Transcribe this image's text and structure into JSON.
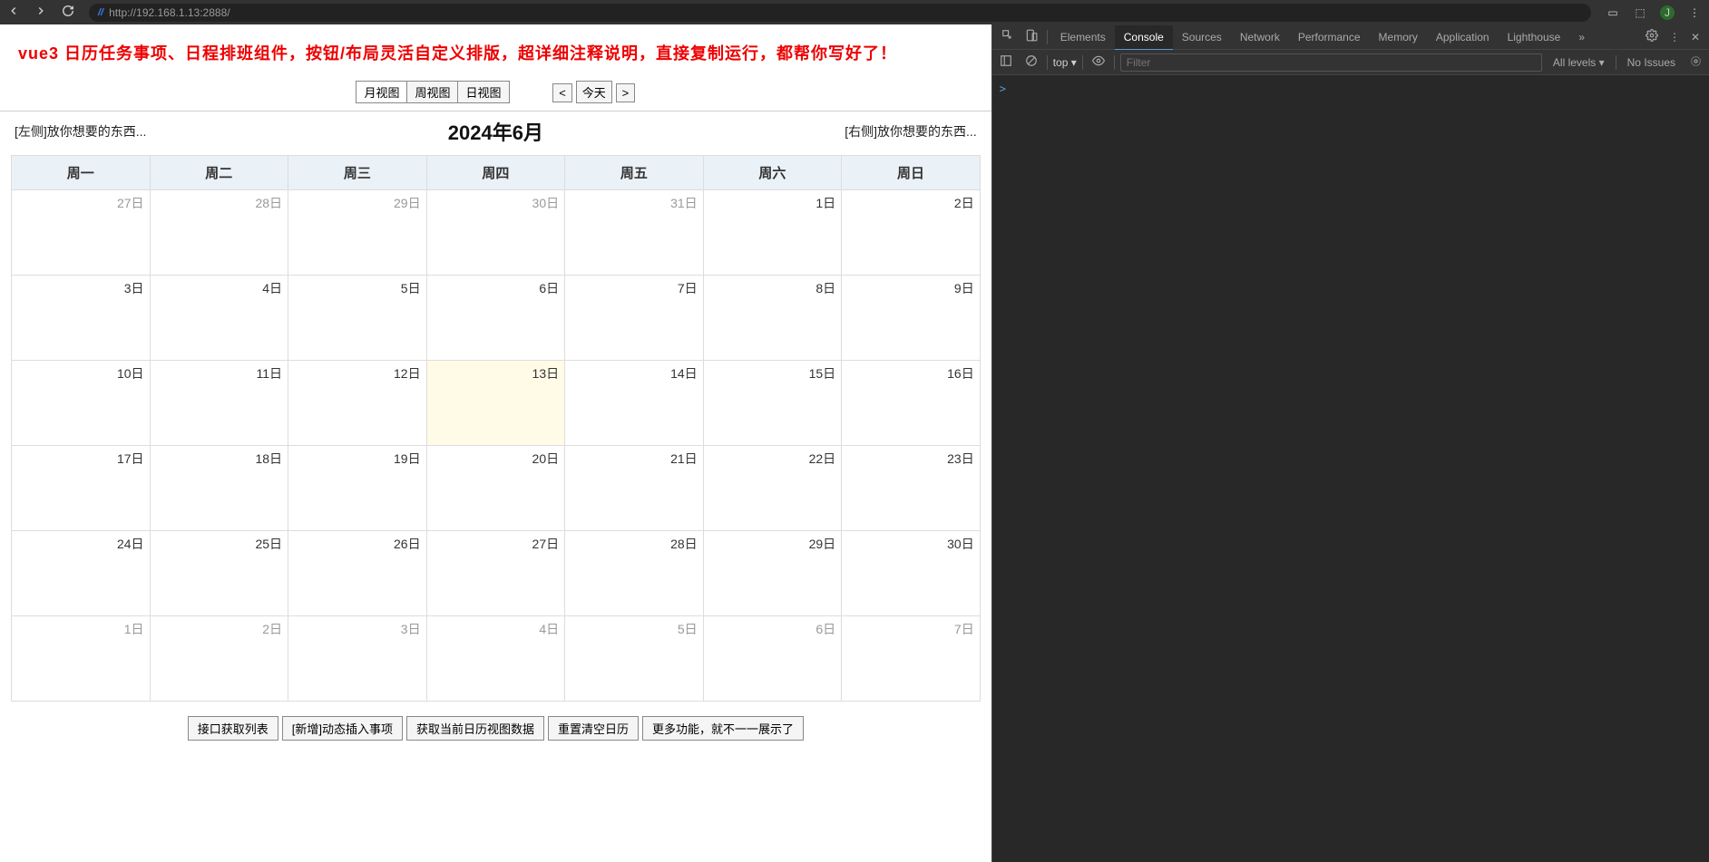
{
  "browser": {
    "url": "http://192.168.1.13:2888/",
    "avatar_letter": "J"
  },
  "page": {
    "header_title": "vue3 日历任务事项、日程排班组件，按钮/布局灵活自定义排版，超详细注释说明，直接复制运行，都帮你写好了！",
    "views": [
      "月视图",
      "周视图",
      "日视图"
    ],
    "nav_prev": "<",
    "nav_today": "今天",
    "nav_next": ">",
    "left_slot": "[左侧]放你想要的东西...",
    "cal_title": "2024年6月",
    "right_slot": "[右侧]放你想要的东西...",
    "weekdays": [
      "周一",
      "周二",
      "周三",
      "周四",
      "周五",
      "周六",
      "周日"
    ],
    "cells": [
      [
        {
          "d": "27日",
          "cm": false
        },
        {
          "d": "28日",
          "cm": false
        },
        {
          "d": "29日",
          "cm": false
        },
        {
          "d": "30日",
          "cm": false
        },
        {
          "d": "31日",
          "cm": false
        },
        {
          "d": "1日",
          "cm": true
        },
        {
          "d": "2日",
          "cm": true
        }
      ],
      [
        {
          "d": "3日",
          "cm": true
        },
        {
          "d": "4日",
          "cm": true
        },
        {
          "d": "5日",
          "cm": true
        },
        {
          "d": "6日",
          "cm": true
        },
        {
          "d": "7日",
          "cm": true
        },
        {
          "d": "8日",
          "cm": true
        },
        {
          "d": "9日",
          "cm": true
        }
      ],
      [
        {
          "d": "10日",
          "cm": true
        },
        {
          "d": "11日",
          "cm": true
        },
        {
          "d": "12日",
          "cm": true
        },
        {
          "d": "13日",
          "cm": true,
          "today": true
        },
        {
          "d": "14日",
          "cm": true
        },
        {
          "d": "15日",
          "cm": true
        },
        {
          "d": "16日",
          "cm": true
        }
      ],
      [
        {
          "d": "17日",
          "cm": true
        },
        {
          "d": "18日",
          "cm": true
        },
        {
          "d": "19日",
          "cm": true
        },
        {
          "d": "20日",
          "cm": true
        },
        {
          "d": "21日",
          "cm": true
        },
        {
          "d": "22日",
          "cm": true
        },
        {
          "d": "23日",
          "cm": true
        }
      ],
      [
        {
          "d": "24日",
          "cm": true
        },
        {
          "d": "25日",
          "cm": true
        },
        {
          "d": "26日",
          "cm": true
        },
        {
          "d": "27日",
          "cm": true
        },
        {
          "d": "28日",
          "cm": true
        },
        {
          "d": "29日",
          "cm": true
        },
        {
          "d": "30日",
          "cm": true
        }
      ],
      [
        {
          "d": "1日",
          "cm": false
        },
        {
          "d": "2日",
          "cm": false
        },
        {
          "d": "3日",
          "cm": false
        },
        {
          "d": "4日",
          "cm": false
        },
        {
          "d": "5日",
          "cm": false
        },
        {
          "d": "6日",
          "cm": false
        },
        {
          "d": "7日",
          "cm": false
        }
      ]
    ],
    "bottom_buttons": [
      "接口获取列表",
      "[新增]动态插入事项",
      "获取当前日历视图数据",
      "重置清空日历",
      "更多功能，就不一一展示了"
    ]
  },
  "devtools": {
    "tabs": [
      "Elements",
      "Console",
      "Sources",
      "Network",
      "Performance",
      "Memory",
      "Application",
      "Lighthouse"
    ],
    "active_tab": "Console",
    "more": "»",
    "context": "top",
    "filter_placeholder": "Filter",
    "levels": "All levels",
    "issues": "No Issues",
    "prompt": ">"
  }
}
